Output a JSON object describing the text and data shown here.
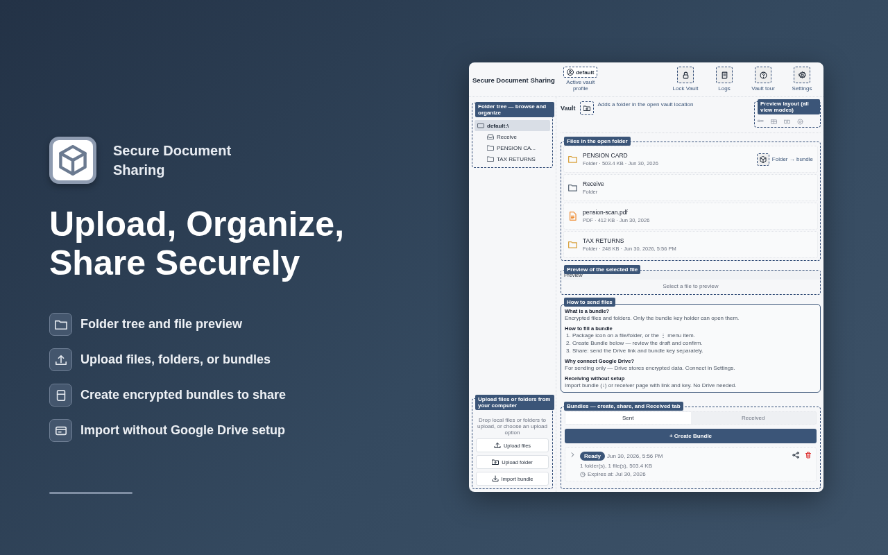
{
  "promo": {
    "app_name": "Secure Document Sharing",
    "headline": "Upload, Organize, Share Securely",
    "features": [
      {
        "kind": "folder",
        "text": "Folder tree and file preview"
      },
      {
        "kind": "upload",
        "text": "Upload files, folders, or bundles"
      },
      {
        "kind": "bundle",
        "text": "Create encrypted bundles to share"
      },
      {
        "kind": "card",
        "text": "Import without Google Drive setup"
      }
    ]
  },
  "app": {
    "title": "Secure Document Sharing",
    "profile": {
      "label": "default",
      "caption": "Active vault profile"
    },
    "toolbar": [
      {
        "kind": "lock",
        "label": "Lock Vault"
      },
      {
        "kind": "logs",
        "label": "Logs"
      },
      {
        "kind": "help",
        "label": "Vault tour"
      },
      {
        "kind": "settings",
        "label": "Settings"
      }
    ],
    "folder_tree": {
      "callout": "Folder tree — browse and organize",
      "items": [
        {
          "kind": "drive",
          "label": "default:\\",
          "selected": true,
          "children": [
            {
              "kind": "inbox",
              "label": "Receive",
              "selected": false
            },
            {
              "kind": "folder",
              "label": "PENSION CA...",
              "selected": false
            },
            {
              "kind": "folder",
              "label": "TAX RETURNS",
              "selected": false
            }
          ]
        }
      ]
    },
    "upload": {
      "callout": "Upload files or folders from your computer",
      "hint": "Drop local files or folders to upload, or choose an upload option",
      "buttons": [
        {
          "kind": "upload",
          "label": "Upload files"
        },
        {
          "kind": "folder-upload",
          "label": "Upload folder"
        },
        {
          "kind": "import",
          "label": "Import bundle"
        }
      ]
    },
    "vault": {
      "title": "Vault",
      "new_folder_hint": "Adds a folder in the open vault location",
      "layout_callout": "Preview layout (all view modes)"
    },
    "files": {
      "callout": "Files in the open folder",
      "rows": [
        {
          "kind": "folder",
          "color": "#d9a23f",
          "name": "PENSION CARD",
          "meta": "Folder · 503.4 KB · Jun 30, 2026",
          "action": "Folder → bundle"
        },
        {
          "kind": "folder",
          "color": "#5f6b7a",
          "name": "Receive",
          "meta": "Folder"
        },
        {
          "kind": "pdf",
          "color": "#f0913a",
          "name": "pension-scan.pdf",
          "meta": "PDF · 412 KB · Jun 30, 2026"
        },
        {
          "kind": "folder",
          "color": "#d9a23f",
          "name": "TAX RETURNS",
          "meta": "Folder · 248 KB · Jun 30, 2026, 5:56 PM"
        }
      ]
    },
    "preview": {
      "callout": "Preview of the selected file",
      "title": "Preview",
      "empty": "Select a file to preview"
    },
    "help": {
      "callout": "How to send files",
      "sections": [
        {
          "heading": "What is a bundle?",
          "lines": [
            "Encrypted files and folders. Only the bundle key holder can open them."
          ]
        },
        {
          "heading": "How to fill a bundle",
          "lines": [
            "1. Package icon on a file/folder, or the ⋮ menu item.",
            "2. Create Bundle below — review the draft and confirm.",
            "3. Share: send the Drive link and bundle key separately."
          ]
        },
        {
          "heading": "Why connect Google Drive?",
          "lines": [
            "For sending only — Drive stores encrypted data. Connect in Settings."
          ]
        },
        {
          "heading": "Receiving without setup",
          "lines": [
            "Import bundle (↓) or receiver page with link and key. No Drive needed."
          ]
        }
      ]
    },
    "bundles": {
      "callout": "Bundles — create, share, and Received tab",
      "tabs": [
        {
          "label": "Sent",
          "selected": true
        },
        {
          "label": "Received",
          "selected": false
        }
      ],
      "create": "+ Create Bundle",
      "items": [
        {
          "status": "Ready",
          "date": "Jun 30, 2026, 5:56 PM",
          "summary": "1 folder(s), 1 file(s), 503.4 KB",
          "expires": "Expires at: Jul 30, 2026",
          "expanded": false
        }
      ]
    }
  }
}
